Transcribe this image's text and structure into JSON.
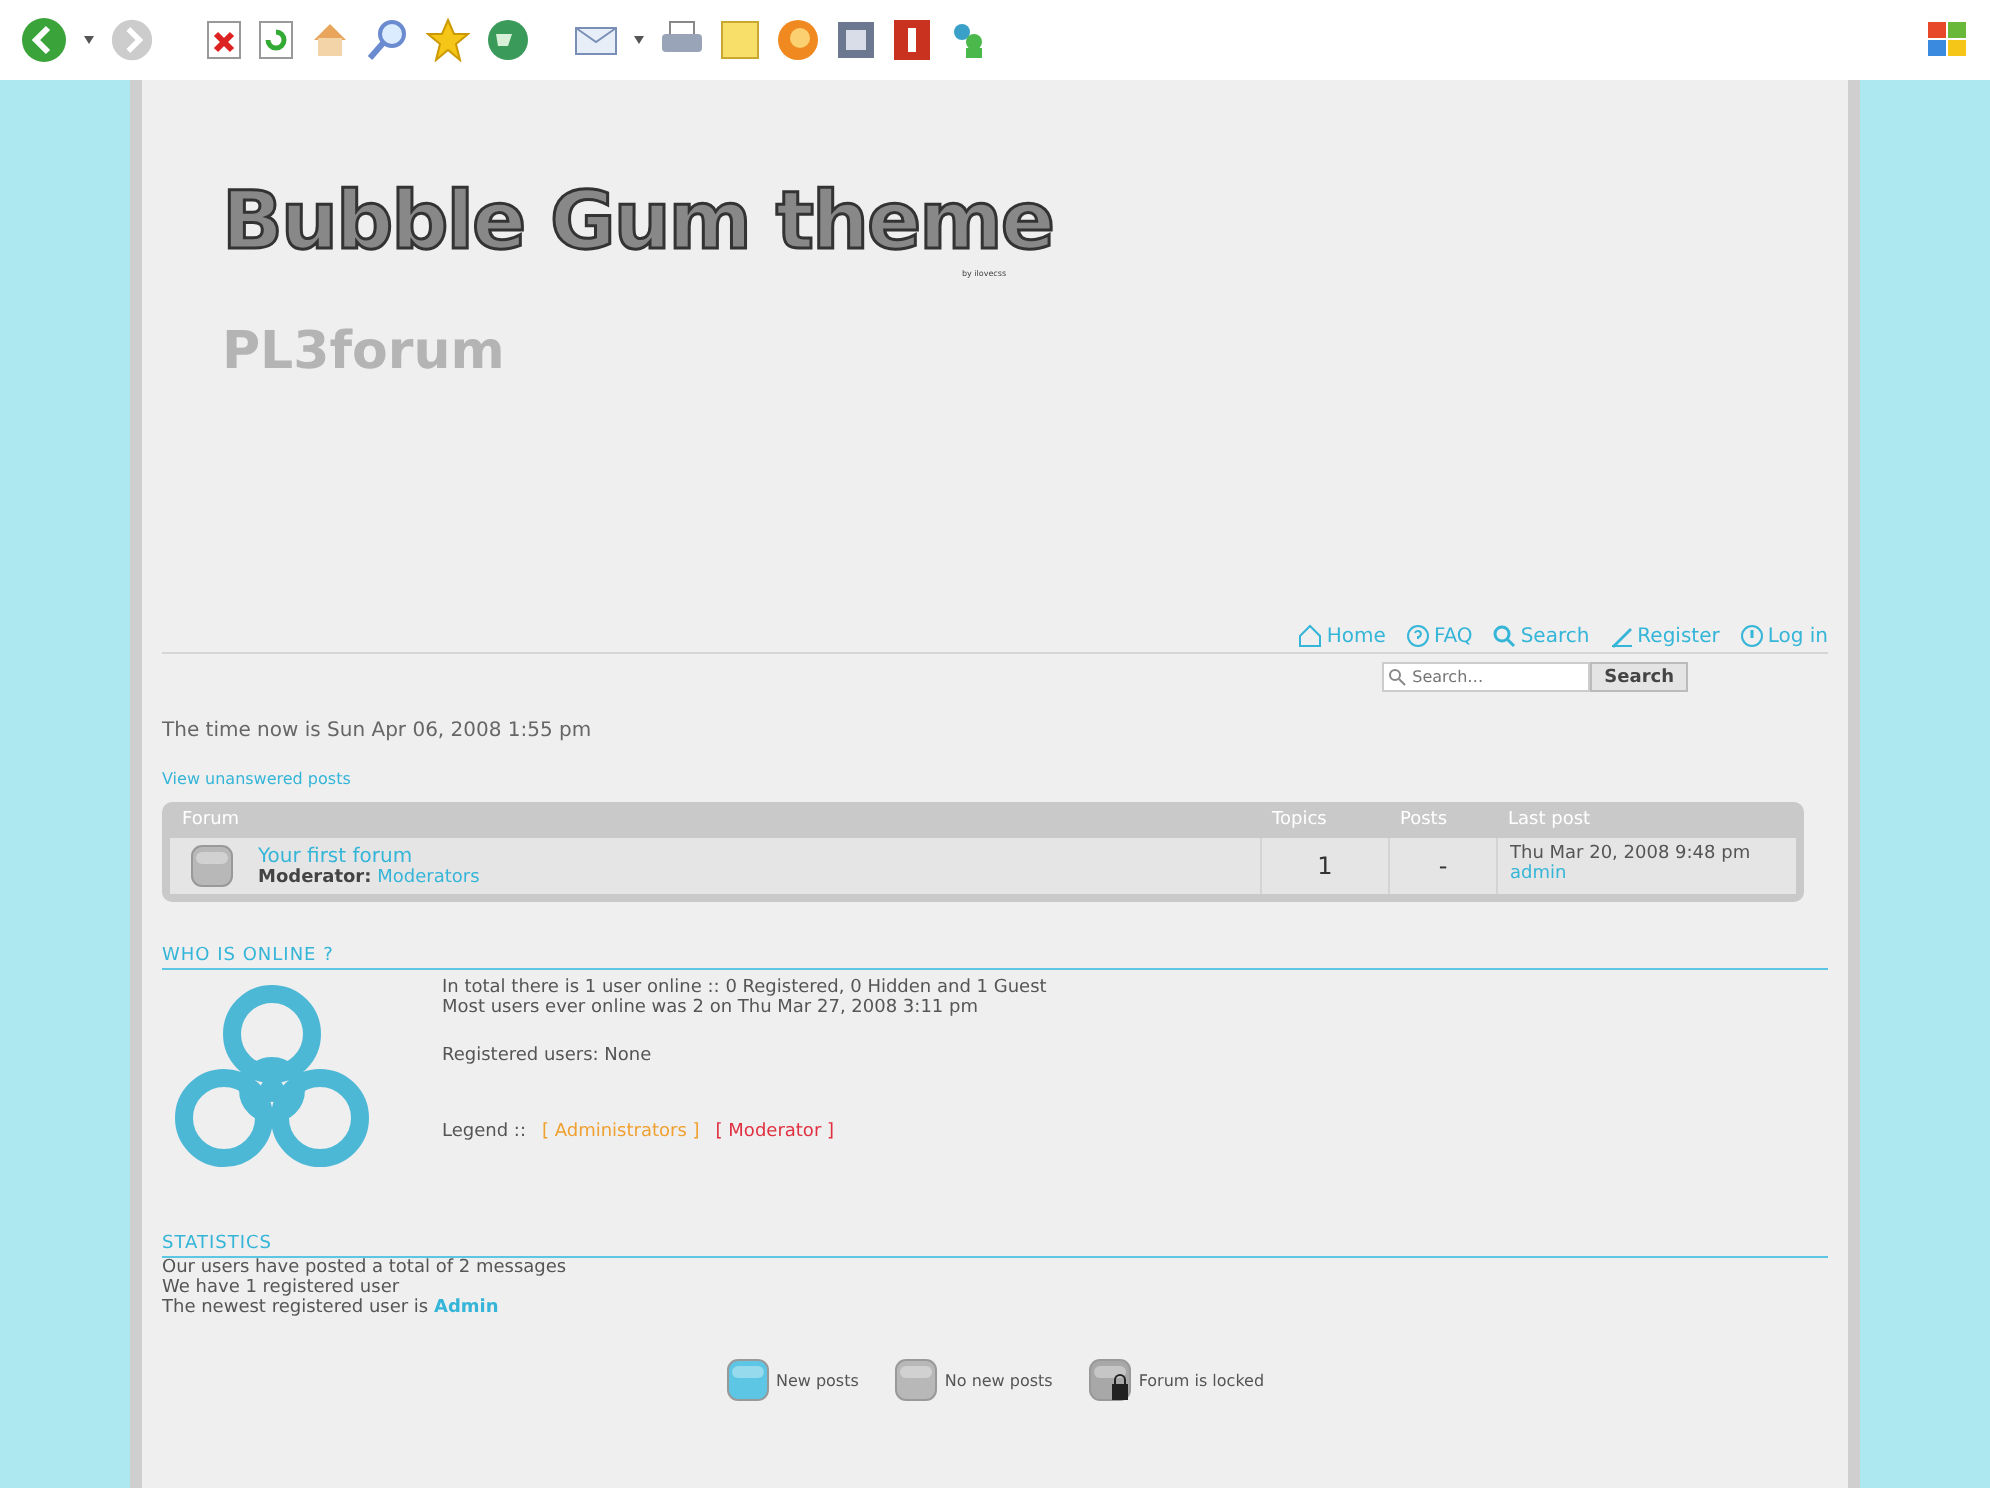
{
  "header": {
    "logo": "Bubble Gum theme",
    "logo_credit": "by ilovecss",
    "site_name": "PL3forum"
  },
  "nav": [
    {
      "label": "Home"
    },
    {
      "label": "FAQ"
    },
    {
      "label": "Search"
    },
    {
      "label": "Register"
    },
    {
      "label": "Log in"
    }
  ],
  "search": {
    "placeholder": "Search…",
    "button": "Search"
  },
  "time_now": "The time now is Sun Apr 06, 2008 1:55 pm",
  "unanswered_link": "View unanswered posts",
  "table": {
    "columns": [
      "Forum",
      "Topics",
      "Posts",
      "Last post"
    ],
    "rows": [
      {
        "kind": "no_new",
        "title": "Your first forum",
        "moderator_label": "Moderator:",
        "moderator": "Moderators",
        "topics": "1",
        "posts": "-",
        "last_post_time": "Thu Mar 20, 2008 9:48 pm",
        "last_post_user": "admin"
      }
    ]
  },
  "who_is_online": {
    "title": "WHO IS ONLINE ?",
    "lines": [
      "In total there is 1 user online :: 0 Registered, 0 Hidden and 1 Guest",
      "Most users ever online was 2 on Thu Mar 27, 2008 3:11 pm"
    ],
    "registered": "Registered users: None",
    "legend_label": "Legend ::",
    "legend": [
      {
        "label": "[ Administrators ]",
        "color": "#f0a030"
      },
      {
        "label": "[ Moderator ]",
        "color": "#e03040"
      }
    ]
  },
  "statistics": {
    "title": "STATISTICS",
    "lines": [
      "Our users have posted a total of 2 messages",
      "We have 1 registered user"
    ],
    "newest_prefix": "The newest registered user is",
    "newest_user": "Admin"
  },
  "icon_legend": [
    {
      "kind": "new",
      "label": "New posts"
    },
    {
      "kind": "no_new",
      "label": "No new posts"
    },
    {
      "kind": "locked",
      "label": "Forum is locked"
    }
  ]
}
